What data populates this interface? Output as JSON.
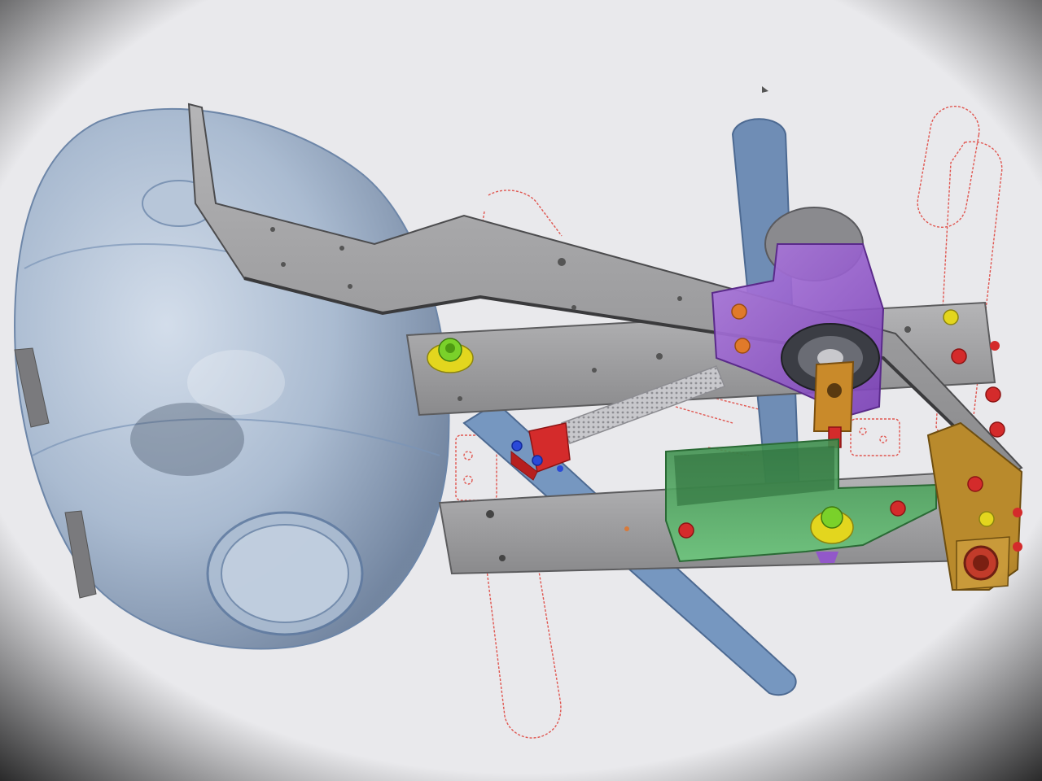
{
  "viewport": {
    "background_color": "#e9e9ec",
    "vignette_color": "#1a1a1e"
  },
  "colors": {
    "tank": "#9fb3cc",
    "tank_edge": "#6d86a8",
    "steel": "#9a9a9c",
    "steel_dark": "#6e6e70",
    "sketch": "#e0554f",
    "rod": "#6f8db5",
    "bracket_green": "#57b86a",
    "housing_purple": "#9258c9",
    "bearing_dark": "#3b3d44",
    "block_orange": "#c98a2a",
    "bolt_red": "#d42b2b",
    "bolt_yellow": "#e3d61e",
    "bolt_green": "#7ad12a",
    "bolt_blue": "#2a49d8",
    "bolt_orange": "#e07a2a",
    "spring": "#b9b9bd"
  },
  "parts": [
    "transparent-tank",
    "upper-bent-arm",
    "middle-plate",
    "lower-plate",
    "blue-rod-vertical",
    "blue-rod-diagonal",
    "purple-bearing-housing",
    "green-u-bracket",
    "orange-end-block",
    "tension-spring",
    "red-sketch-slots"
  ]
}
